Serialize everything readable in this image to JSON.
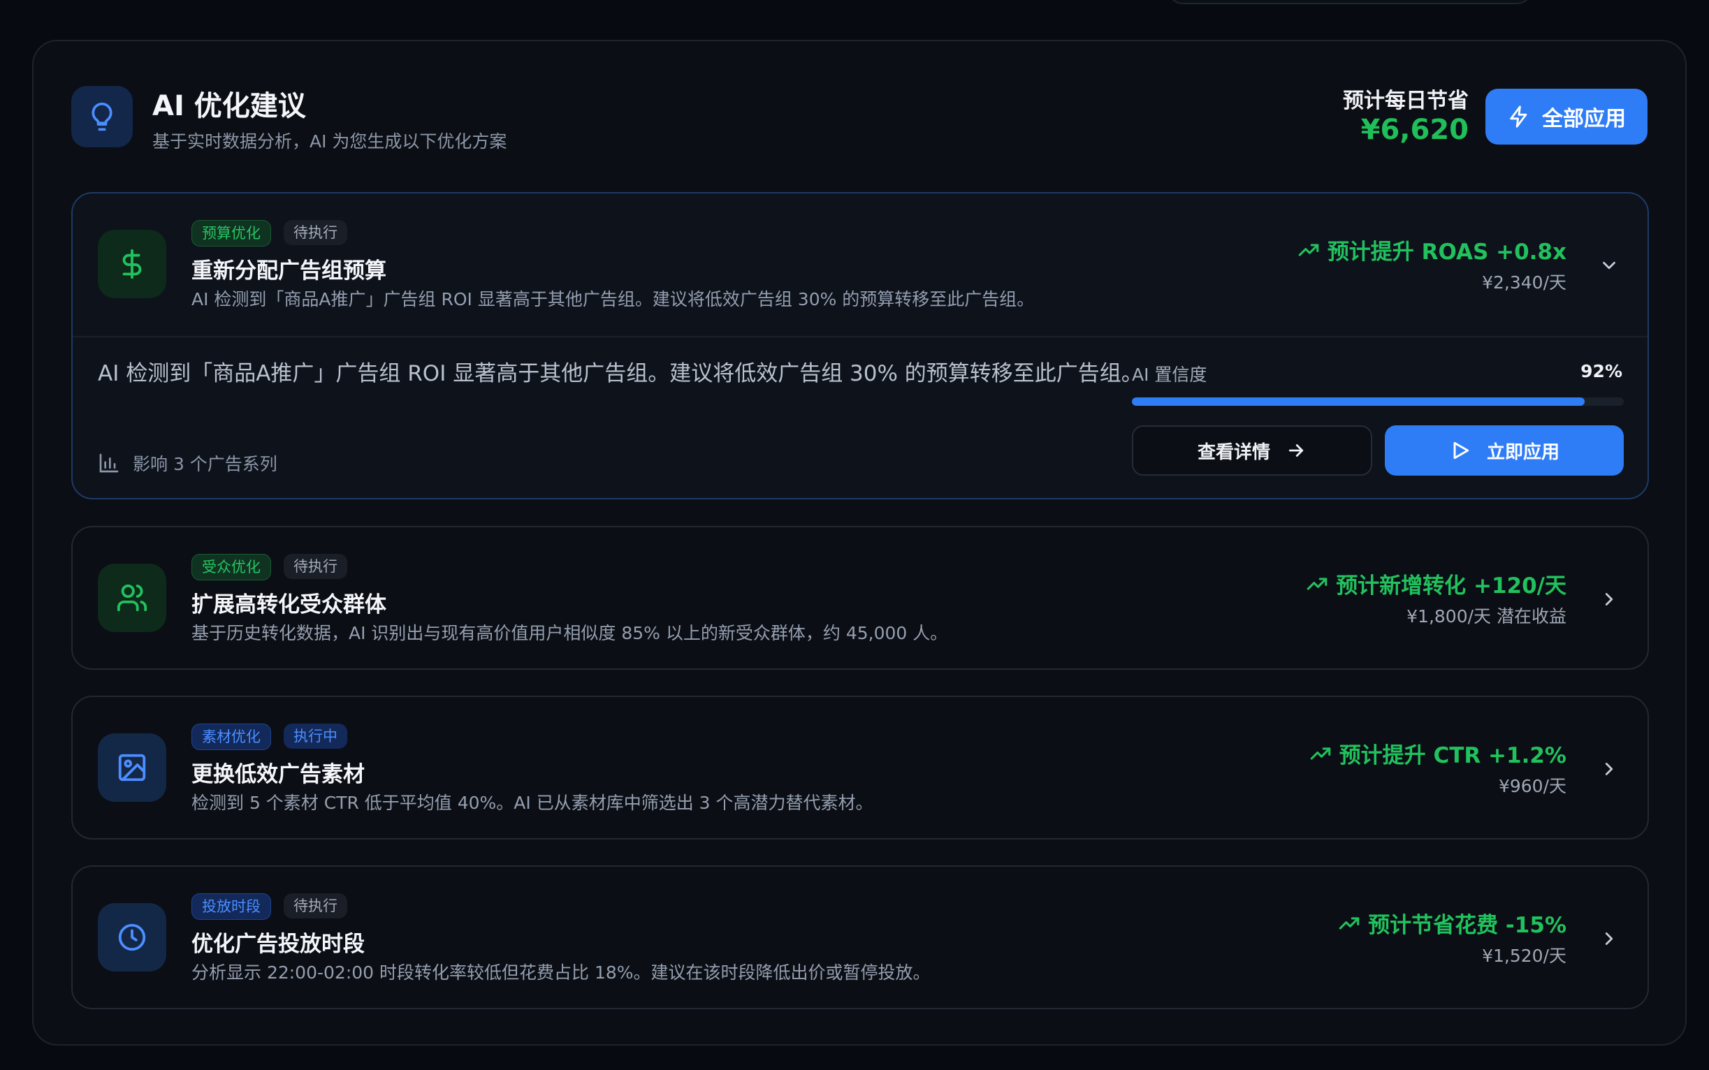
{
  "header": {
    "title": "AI 优化建议",
    "subtitle": "基于实时数据分析，AI 为您生成以下优化方案",
    "savings_label": "预计每日节省",
    "savings_value": "¥6,620",
    "apply_all_label": "全部应用",
    "icon": "lightbulb-icon"
  },
  "colors": {
    "accent": "#2f7df6",
    "positive": "#21c25e",
    "panel": "#0b0e14",
    "background": "#070a10"
  },
  "cards": [
    {
      "category": "预算优化",
      "status": "待执行",
      "title": "重新分配广告组预算",
      "desc": "AI 检测到「商品A推广」广告组 ROI 显著高于其他广告组。建议将低效广告组 30% 的预算转移至此广告组。",
      "metric": "预计提升 ROAS +0.8x",
      "metric_sub": "¥2,340/天",
      "icon": "dollar-icon",
      "expanded": true,
      "detail": {
        "text": "AI 检测到「商品A推广」广告组 ROI 显著高于其他广告组。建议将低效广告组 30% 的预算转移至此广告组。",
        "impact": "影响 3 个广告系列",
        "confidence_label": "AI 置信度",
        "confidence_value": "92%",
        "confidence_fraction": 0.92,
        "view_details_label": "查看详情",
        "apply_now_label": "立即应用"
      }
    },
    {
      "category": "受众优化",
      "status": "待执行",
      "title": "扩展高转化受众群体",
      "desc": "基于历史转化数据，AI 识别出与现有高价值用户相似度 85% 以上的新受众群体，约 45,000 人。",
      "metric": "预计新增转化 +120/天",
      "metric_sub": "¥1,800/天 潜在收益",
      "icon": "users-icon",
      "expanded": false
    },
    {
      "category": "素材优化",
      "status": "执行中",
      "title": "更换低效广告素材",
      "desc": "检测到 5 个素材 CTR 低于平均值 40%。AI 已从素材库中筛选出 3 个高潜力替代素材。",
      "metric": "预计提升 CTR +1.2%",
      "metric_sub": "¥960/天",
      "icon": "image-icon",
      "expanded": false
    },
    {
      "category": "投放时段",
      "status": "待执行",
      "title": "优化广告投放时段",
      "desc": "分析显示 22:00-02:00 时段转化率较低但花费占比 18%。建议在该时段降低出价或暂停投放。",
      "metric": "预计节省花费 -15%",
      "metric_sub": "¥1,520/天",
      "icon": "clock-icon",
      "expanded": false
    }
  ]
}
